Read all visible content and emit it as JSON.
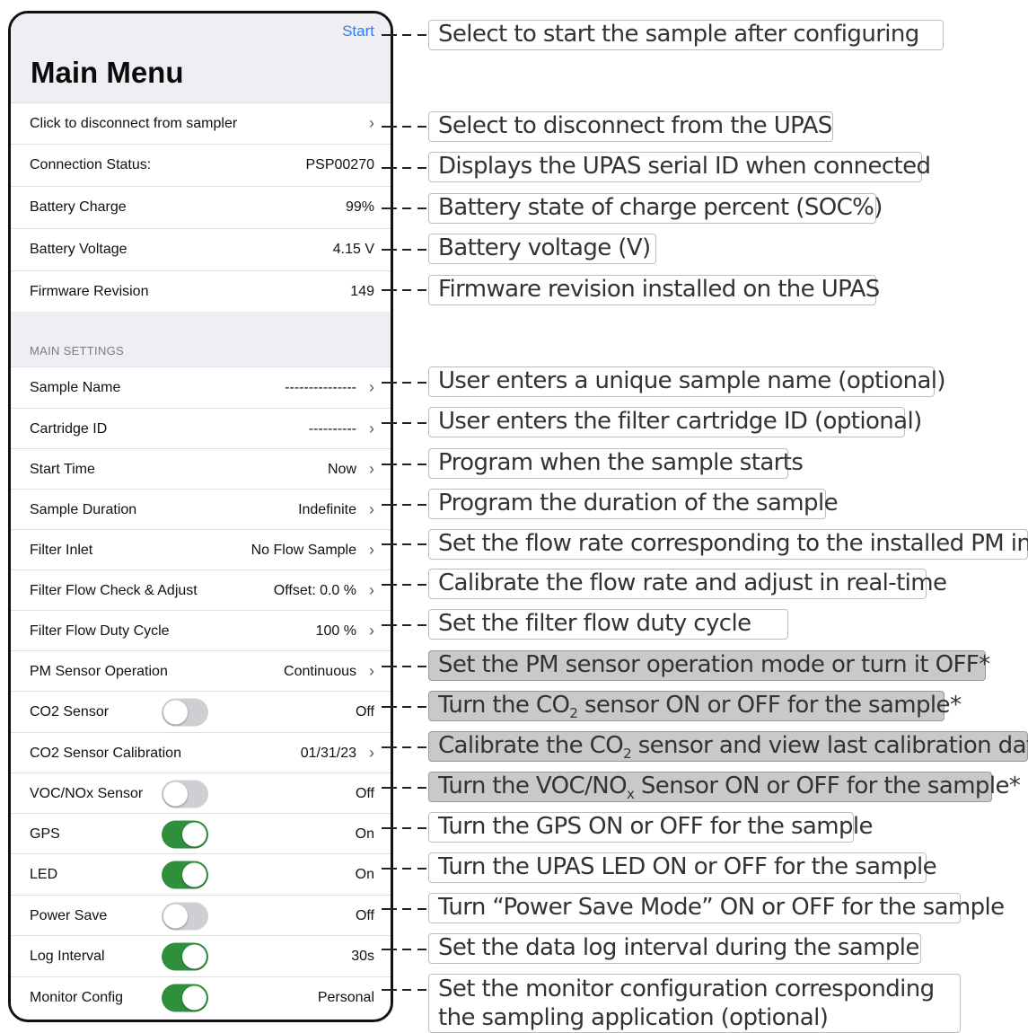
{
  "app": {
    "start_label": "Start",
    "title": "Main Menu"
  },
  "rows": {
    "disconnect": {
      "label": "Click to disconnect from sampler"
    },
    "connection": {
      "label": "Connection Status:",
      "value": "PSP00270"
    },
    "battery_charge": {
      "label": "Battery Charge",
      "value": "99%"
    },
    "battery_voltage": {
      "label": "Battery Voltage",
      "value": "4.15 V"
    },
    "firmware": {
      "label": "Firmware Revision",
      "value": "149"
    }
  },
  "section": {
    "label": "MAIN SETTINGS"
  },
  "settings": {
    "sample_name": {
      "label": "Sample Name",
      "value": "---------------"
    },
    "cartridge_id": {
      "label": "Cartridge ID",
      "value": "----------"
    },
    "start_time": {
      "label": "Start Time",
      "value": "Now"
    },
    "sample_duration": {
      "label": "Sample Duration",
      "value": "Indefinite"
    },
    "filter_inlet": {
      "label": "Filter Inlet",
      "value": "No Flow Sample"
    },
    "flow_check": {
      "label": "Filter Flow Check & Adjust",
      "value": "Offset: 0.0 %"
    },
    "duty_cycle": {
      "label": "Filter Flow Duty Cycle",
      "value": "100 %"
    },
    "pm_sensor": {
      "label": "PM Sensor Operation",
      "value": "Continuous"
    },
    "co2_sensor": {
      "label": "CO2 Sensor",
      "value": "Off",
      "toggle": "off"
    },
    "co2_cal": {
      "label": "CO2 Sensor Calibration",
      "value": "01/31/23"
    },
    "voc_sensor": {
      "label": "VOC/NOx Sensor",
      "value": "Off",
      "toggle": "off"
    },
    "gps": {
      "label": "GPS",
      "value": "On",
      "toggle": "on"
    },
    "led": {
      "label": "LED",
      "value": "On",
      "toggle": "on"
    },
    "power_save": {
      "label": "Power Save",
      "value": "Off",
      "toggle": "off"
    },
    "log_interval": {
      "label": "Log Interval",
      "value": "30s",
      "toggle": "on"
    },
    "monitor_config": {
      "label": "Monitor Config",
      "value": "Personal",
      "toggle": "on"
    }
  },
  "annotations": {
    "start": "Select to start the sample after configuring",
    "disconnect": "Select to disconnect from the UPAS",
    "connection": "Displays the UPAS serial ID when connected",
    "battery_charge": "Battery state of charge percent (SOC%)",
    "battery_voltage": "Battery voltage (V)",
    "firmware": "Firmware revision installed on the UPAS",
    "sample_name": "User enters a unique sample name (optional)",
    "cartridge_id": "User enters the filter cartridge ID (optional)",
    "start_time": "Program when the sample starts",
    "sample_duration": "Program the duration of the sample",
    "filter_inlet": "Set the flow rate corresponding to the installed PM inlet",
    "flow_check": "Calibrate the flow rate and adjust in real-time",
    "duty_cycle": "Set the filter flow duty cycle",
    "pm_sensor": "Set the PM sensor operation mode or turn it OFF*",
    "co2_sensor_a": "Turn the CO",
    "co2_sensor_sub": "2",
    "co2_sensor_b": " sensor ON or OFF for the sample*",
    "co2_cal_a": "Calibrate the CO",
    "co2_cal_sub": "2",
    "co2_cal_b": " sensor and view last calibration date*",
    "voc_a": "Turn the VOC/NO",
    "voc_sub": "x",
    "voc_b": " Sensor ON or OFF for the sample*",
    "gps": "Turn the GPS ON or OFF for the sample",
    "led": "Turn the UPAS LED ON or OFF for the sample",
    "power_save": "Turn “Power Save Mode” ON or OFF for the sample",
    "log_interval": "Set the data log interval during the sample",
    "monitor_config": "Set the monitor configuration corresponding the sampling application (optional)"
  },
  "colors": {
    "accent": "#2f7cf6",
    "toggle_on": "#2f8f3c",
    "toggle_off": "#cfcfd3",
    "header_bg": "#efeff3",
    "shaded_annotation": "#c9c9c9"
  }
}
